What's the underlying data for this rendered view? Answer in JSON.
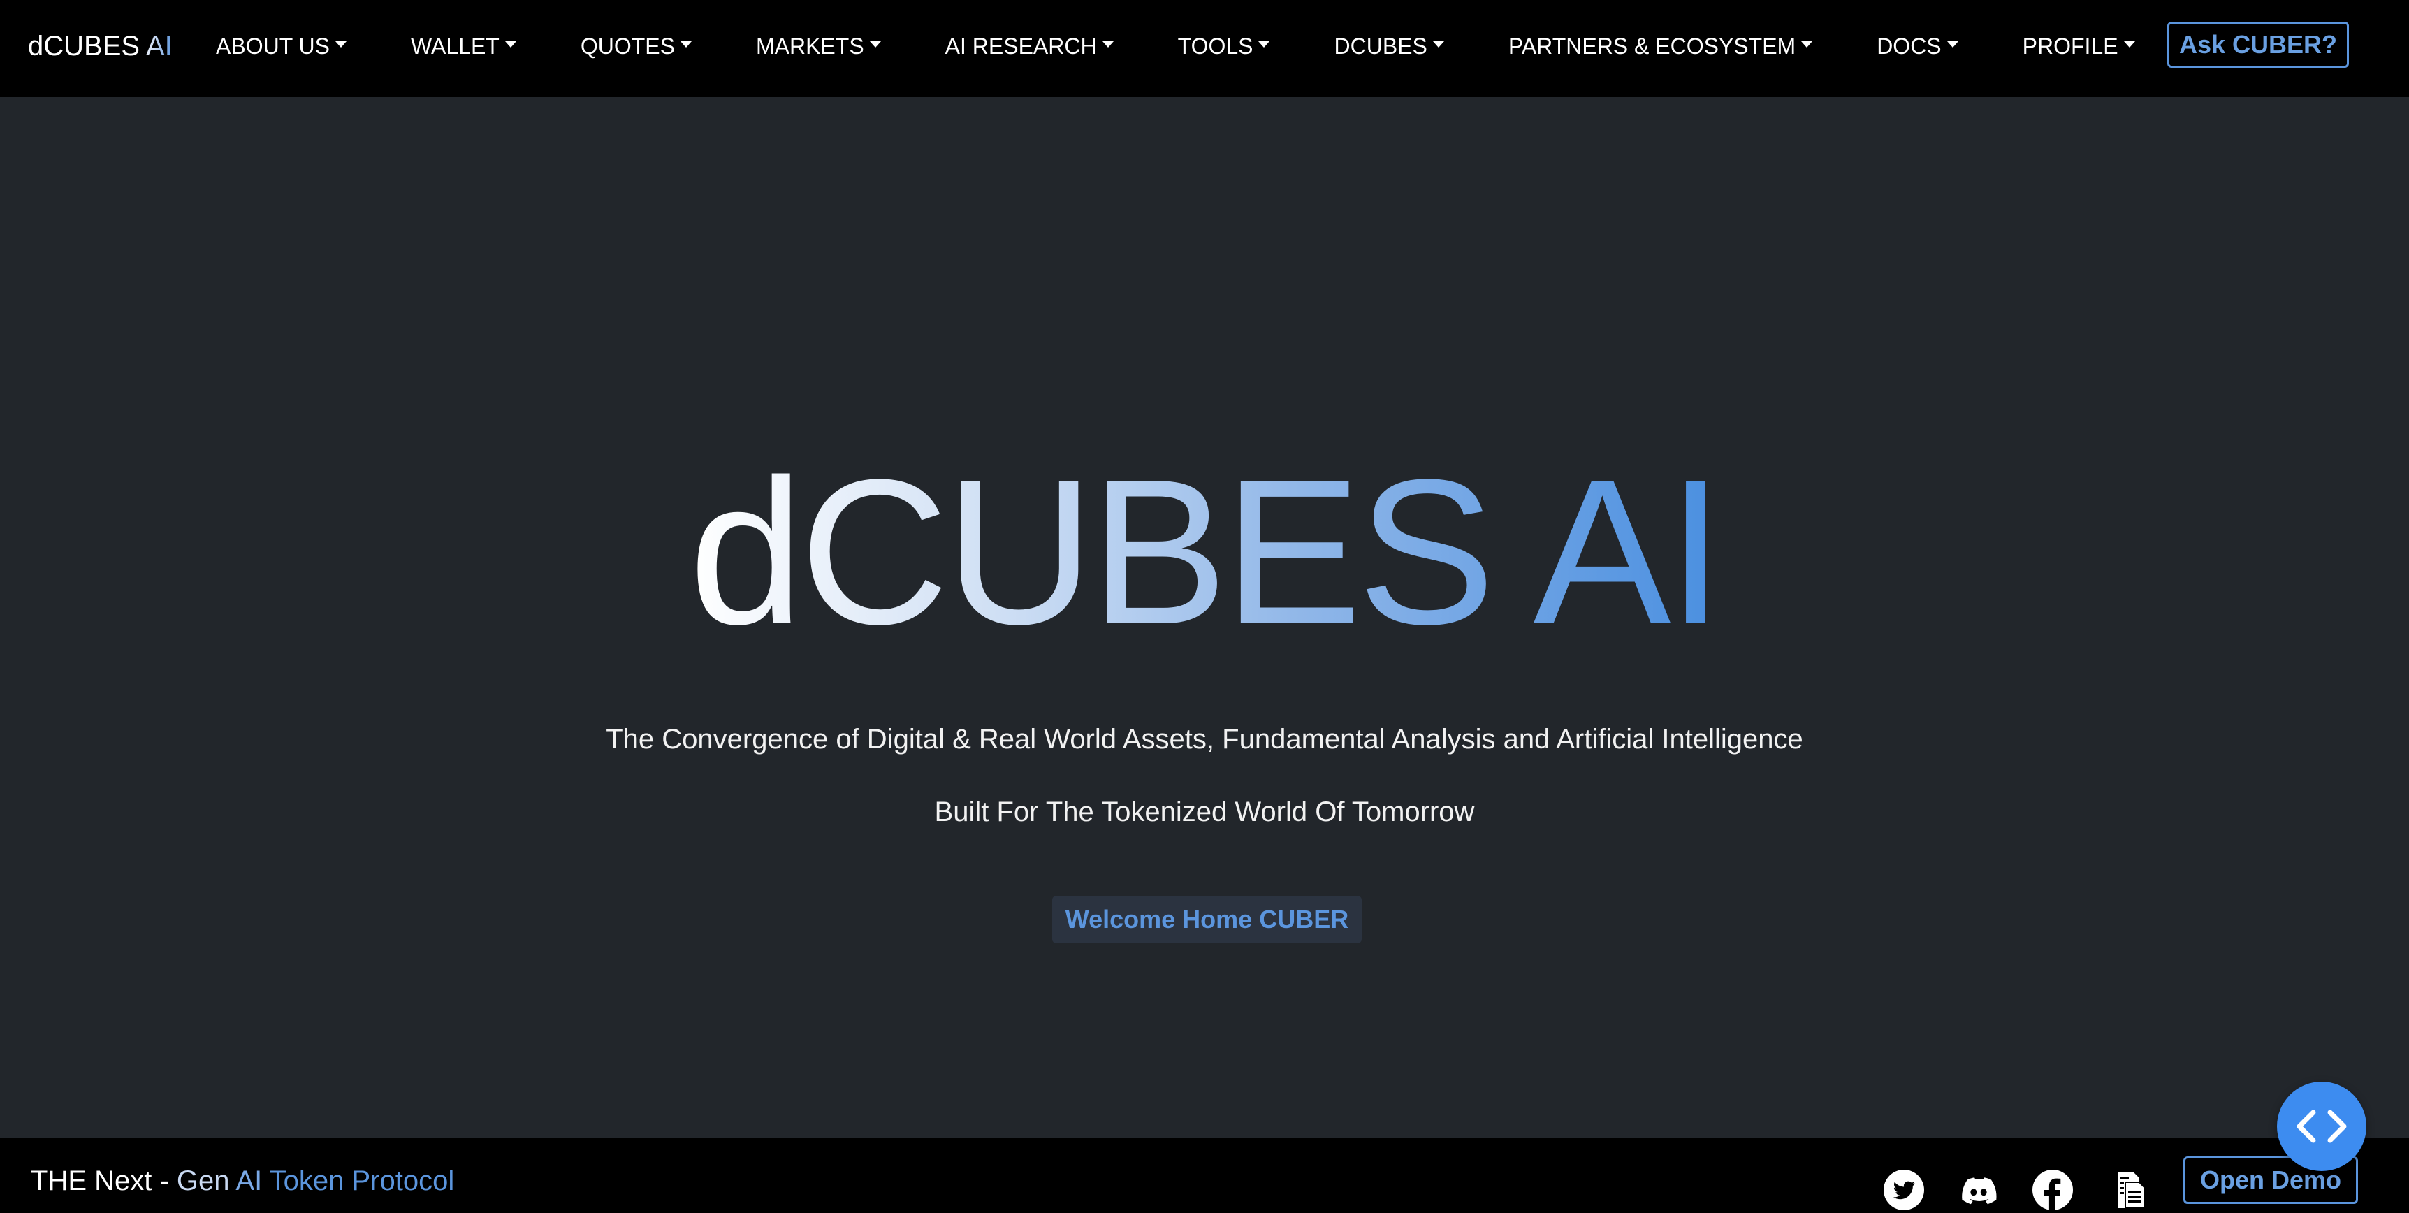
{
  "navbar": {
    "brand_prefix": "dCUBES",
    "brand_suffix": " AI",
    "items": [
      {
        "label": "ABOUT US"
      },
      {
        "label": "WALLET"
      },
      {
        "label": "QUOTES"
      },
      {
        "label": "MARKETS"
      },
      {
        "label": "AI RESEARCH"
      },
      {
        "label": "TOOLS"
      },
      {
        "label": "DCUBES"
      },
      {
        "label": "PARTNERS & ECOSYSTEM"
      },
      {
        "label": "DOCS"
      },
      {
        "label": "PROFILE"
      }
    ],
    "ask_button": "Ask CUBER?"
  },
  "hero": {
    "title": "dCUBES AI",
    "tagline": "The Convergence of Digital & Real World Assets, Fundamental Analysis and Artificial Intelligence",
    "subtagline": "Built For The Tokenized World Of Tomorrow",
    "cta": "Welcome Home CUBER"
  },
  "footer": {
    "text_part1": "THE Next - ",
    "text_part2": "Gen ",
    "text_part3": "AI ",
    "text_part4": "Token Protocol",
    "social_icons": [
      "twitter-icon",
      "discord-icon",
      "facebook-icon",
      "document-icon"
    ],
    "demo_button": "Open Demo"
  },
  "floating_button": {
    "icon": "code-brackets-icon"
  },
  "colors": {
    "background": "#22262b",
    "navbar": "#000000",
    "accent": "#5b95dd",
    "fab": "#3d8cf0"
  }
}
